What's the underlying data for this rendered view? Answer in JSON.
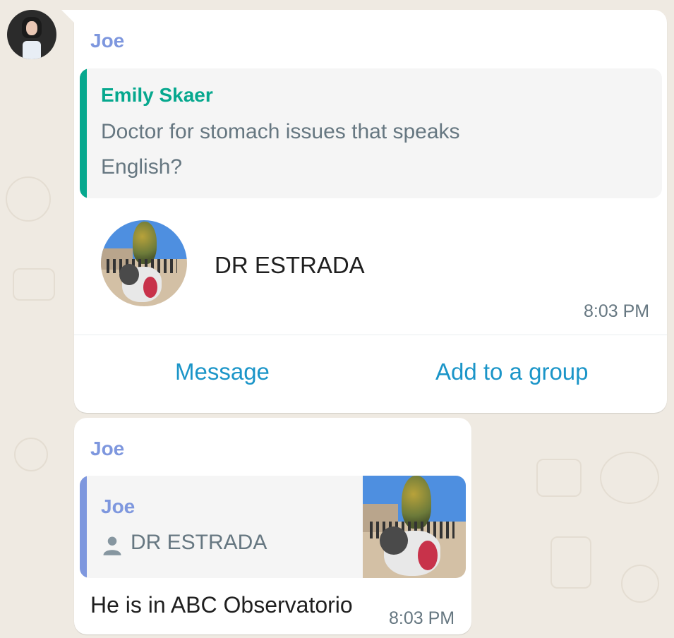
{
  "avatar": {
    "alt": "profile photo"
  },
  "message1": {
    "sender": "Joe",
    "quote": {
      "author": "Emily Skaer",
      "text_line1": "Doctor for stomach issues that speaks",
      "text_line2": "English?"
    },
    "contact": {
      "name": "DR ESTRADA"
    },
    "time": "8:03 PM",
    "actions": {
      "message": "Message",
      "add_to_group": "Add to a group"
    }
  },
  "message2": {
    "sender": "Joe",
    "quote": {
      "author": "Joe",
      "contact_name": "DR ESTRADA"
    },
    "text": "He is in ABC Observatorio",
    "time": "8:03 PM"
  },
  "colors": {
    "background": "#efeae2",
    "bubble": "#ffffff",
    "sender": "#7e97de",
    "quote_accent_green": "#06a88e",
    "quote_accent_blue": "#7e97de",
    "link": "#1b95c8",
    "meta_text": "#667781"
  },
  "icons": {
    "contact": "person-icon"
  }
}
